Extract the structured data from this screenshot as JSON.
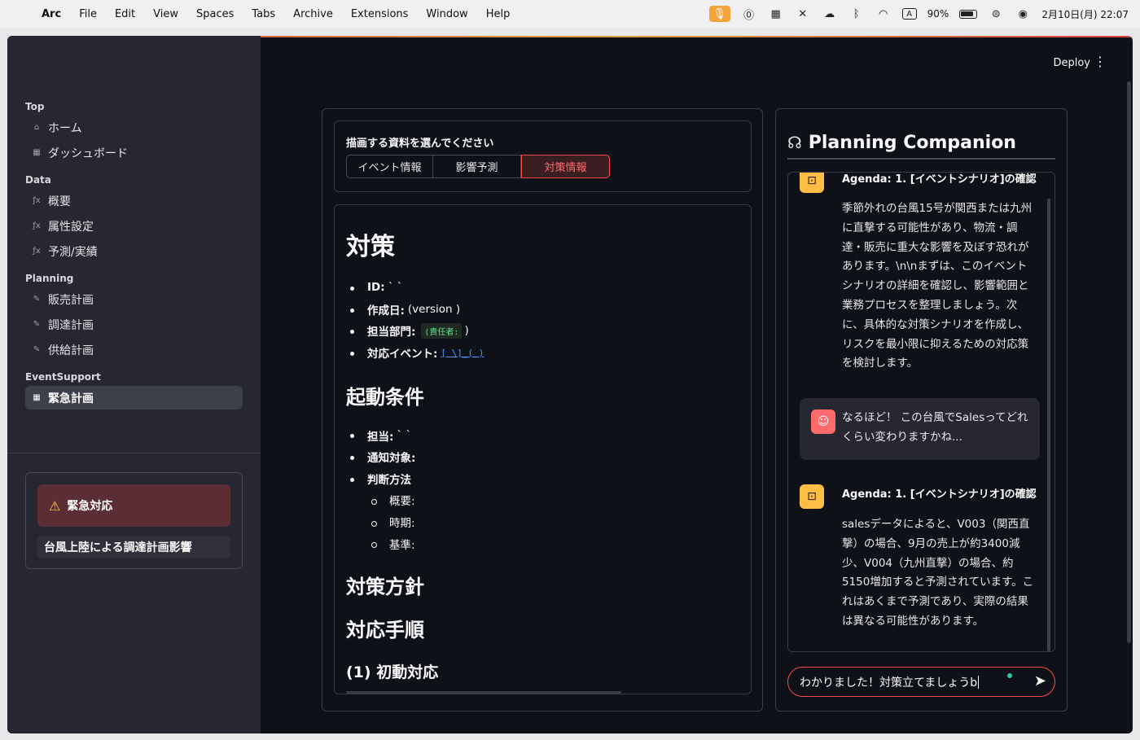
{
  "menubar": {
    "apple": "",
    "app_name": "Arc",
    "menus": [
      "File",
      "Edit",
      "View",
      "Spaces",
      "Tabs",
      "Archive",
      "Extensions",
      "Window",
      "Help"
    ],
    "battery": "90%",
    "input_method": "A",
    "datetime": "2月10日(月) 22:07"
  },
  "header": {
    "deploy": "Deploy",
    "kebab": "⋮"
  },
  "sidebar": {
    "sections": [
      {
        "title": "Top",
        "items": [
          {
            "label": "ホーム",
            "icon": "home-icon",
            "glyph": "⌂"
          },
          {
            "label": "ダッシュボード",
            "icon": "dashboard-icon",
            "glyph": "▦"
          }
        ]
      },
      {
        "title": "Data",
        "items": [
          {
            "label": "概要",
            "icon": "function-icon",
            "glyph": "ƒx"
          },
          {
            "label": "属性設定",
            "icon": "function-icon",
            "glyph": "ƒx"
          },
          {
            "label": "予測/実績",
            "icon": "function-icon",
            "glyph": "ƒx"
          }
        ]
      },
      {
        "title": "Planning",
        "items": [
          {
            "label": "販売計画",
            "icon": "pencil-icon",
            "glyph": "✎"
          },
          {
            "label": "調達計画",
            "icon": "pencil-icon",
            "glyph": "✎"
          },
          {
            "label": "供給計画",
            "icon": "pencil-icon",
            "glyph": "✎"
          }
        ]
      },
      {
        "title": "EventSupport",
        "items": [
          {
            "label": "緊急計画",
            "icon": "dashboard-icon",
            "glyph": "▦",
            "active": true
          }
        ]
      }
    ],
    "alert": {
      "title": "緊急対応",
      "icon": "warning-icon",
      "text": "台風上陸による調達計画影響"
    }
  },
  "selector": {
    "label": "描画する資料を選んでください",
    "options": [
      "イベント情報",
      "影響予測",
      "対策情報"
    ],
    "selected": "対策情報"
  },
  "doc": {
    "h1": "対策",
    "fields": [
      {
        "key": "ID:",
        "value": "` `"
      },
      {
        "key": "作成日:",
        "value": "(version )"
      },
      {
        "key": "担当部門:",
        "code": "(責任者:",
        "value": ")"
      },
      {
        "key": "対応イベント:",
        "link": "[ \\]_( )"
      }
    ],
    "h2_trigger": "起動条件",
    "trigger_items": [
      {
        "key": "担当:",
        "value": "` `"
      },
      {
        "key": "通知対象:",
        "value": ""
      },
      {
        "key": "判断方法",
        "value": ""
      }
    ],
    "sub_items": [
      "概要:",
      "時期:",
      "基準:"
    ],
    "h2_policy": "対策方針",
    "h2_procedure": "対応手順",
    "h3_initial": "(1) 初動対応"
  },
  "chat": {
    "title": "Planning Companion",
    "messages": [
      {
        "role": "bot",
        "title": "Agenda: 1. [イベントシナリオ]の確認",
        "body": "季節外れの台風15号が関西または九州に直撃する可能性があり、物流・調達・販売に重大な影響を及ぼす恐れがあります。\\n\\nまずは、このイベントシナリオの詳細を確認し、影響範囲と業務プロセスを整理しましょう。次に、具体的な対策シナリオを作成し、リスクを最小限に抑えるための対応策を検討します。"
      },
      {
        "role": "user",
        "body": "なるほど！ この台風でSalesってどれくらい変わりますかね..."
      },
      {
        "role": "bot",
        "title": "Agenda: 1. [イベントシナリオ]の確認",
        "body": "salesデータによると、V003（関西直撃）の場合、9月の売上が約3400減少、V004（九州直撃）の場合、約5150増加すると予測されています。これはあくまで予測であり、実際の結果は異なる可能性があります。"
      }
    ],
    "input_value": "わかりました！対策立てましょうb"
  }
}
